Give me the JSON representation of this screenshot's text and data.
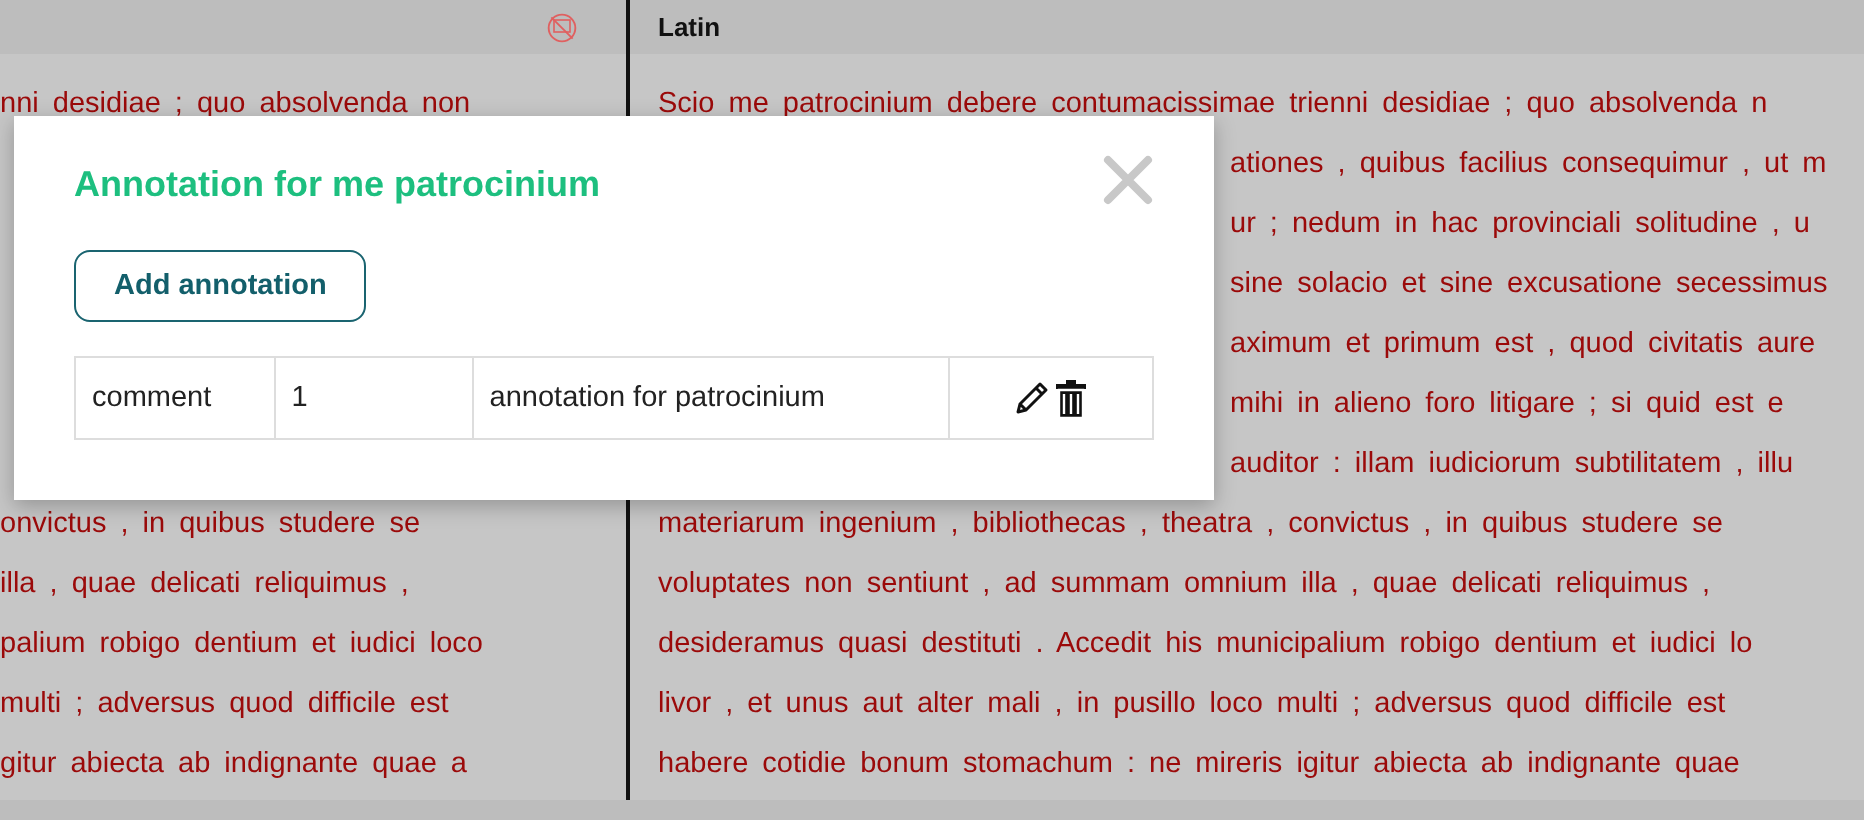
{
  "left_pane": {
    "lines_above_dialog": [
      "nni desidiae ; quo absolvenda non"
    ],
    "lines_below_dialog": [
      "onvictus , in quibus studere se",
      "illa , quae delicati reliquimus ,",
      "palium robigo dentium et iudici loco",
      "multi ; adversus quod difficile est",
      "gitur abiecta ab indignante quae a"
    ]
  },
  "right_pane": {
    "header": "Latin",
    "lines": [
      {
        "text": "Scio me patrocinium debere contumacissimae trienni desidiae ; quo absolvenda n",
        "covered": false
      },
      {
        "text": "ationes , quibus facilius consequimur , ut m",
        "covered": true
      },
      {
        "text": "ur ; nedum in hac provinciali solitudine , u",
        "covered": true
      },
      {
        "text": "sine solacio et sine excusatione secessimus",
        "covered": true
      },
      {
        "text": "aximum et primum est , quod civitatis aure",
        "covered": true
      },
      {
        "text": "mihi in alieno foro litigare ; si quid est e",
        "covered": true
      },
      {
        "text": "auditor : illam iudiciorum subtilitatem , illu",
        "covered": true
      },
      {
        "text": "materiarum ingenium , bibliothecas , theatra , convictus , in quibus studere se",
        "covered": false
      },
      {
        "text": "voluptates non sentiunt , ad summam omnium illa , quae delicati reliquimus ,",
        "covered": false
      },
      {
        "text": "desideramus quasi destituti . Accedit his municipalium robigo dentium et iudici lo",
        "covered": false
      },
      {
        "text": "livor , et unus aut alter mali , in pusillo loco multi ; adversus quod difficile est",
        "covered": false
      },
      {
        "text": "habere cotidie bonum stomachum : ne mireris igitur abiecta ab indignante quae",
        "covered": false
      }
    ]
  },
  "dialog": {
    "title": "Annotation for me patrocinium",
    "add_button": "Add annotation",
    "rows": [
      {
        "cells": [
          "comment",
          "1",
          "annotation for patrocinium"
        ]
      }
    ]
  }
}
